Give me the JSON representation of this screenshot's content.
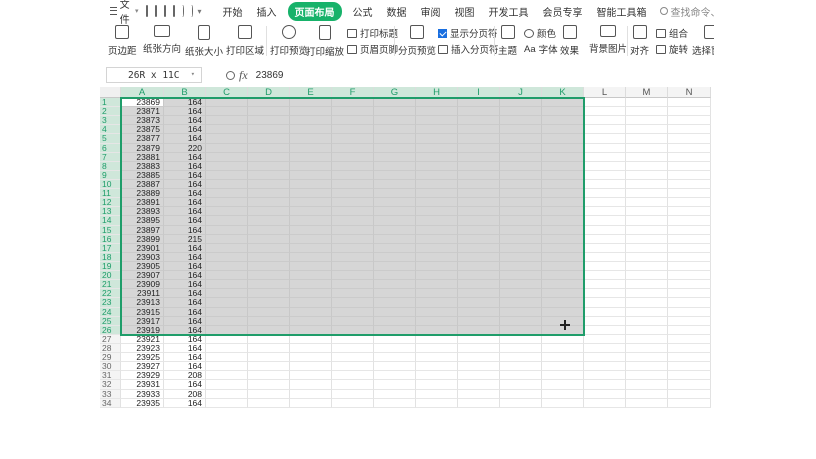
{
  "menubar": {
    "file_label": "文件",
    "tabs": [
      "开始",
      "插入",
      "页面布局",
      "公式",
      "数据",
      "审阅",
      "视图",
      "开发工具",
      "会员专享",
      "智能工具箱"
    ],
    "active_tab": "页面布局",
    "search_placeholder": "查找命令、搜索模板"
  },
  "ribbon": {
    "margins": "页边距",
    "orientation": "纸张方向",
    "size": "纸张大小",
    "print_area": "打印区域",
    "print_preview": "打印预览",
    "print_scale": "打印缩放",
    "print_titles": "打印标题",
    "header_footer": "页眉页脚",
    "page_break_preview": "分页预览",
    "show_page_break": "显示分页符",
    "insert_page_break": "插入分页符",
    "theme": "主题",
    "colors": "颜色",
    "fonts": "字体",
    "effects": "效果",
    "background": "背景图片",
    "align": "对齐",
    "group": "组合",
    "rotate": "旋转",
    "selection_pane": "选择窗格"
  },
  "formula_bar": {
    "name_box": "26R x 11C",
    "fx": "fx",
    "value": "23869"
  },
  "grid": {
    "columns": [
      "A",
      "B",
      "C",
      "D",
      "E",
      "F",
      "G",
      "H",
      "I",
      "J",
      "K",
      "L",
      "M",
      "N"
    ],
    "selected_columns": 11,
    "selected_rows": 26,
    "rows": [
      [
        "1",
        "23869",
        "164"
      ],
      [
        "2",
        "23871",
        "164"
      ],
      [
        "3",
        "23873",
        "164"
      ],
      [
        "4",
        "23875",
        "164"
      ],
      [
        "5",
        "23877",
        "164"
      ],
      [
        "6",
        "23879",
        "220"
      ],
      [
        "7",
        "23881",
        "164"
      ],
      [
        "8",
        "23883",
        "164"
      ],
      [
        "9",
        "23885",
        "164"
      ],
      [
        "10",
        "23887",
        "164"
      ],
      [
        "11",
        "23889",
        "164"
      ],
      [
        "12",
        "23891",
        "164"
      ],
      [
        "13",
        "23893",
        "164"
      ],
      [
        "14",
        "23895",
        "164"
      ],
      [
        "15",
        "23897",
        "164"
      ],
      [
        "16",
        "23899",
        "215"
      ],
      [
        "17",
        "23901",
        "164"
      ],
      [
        "18",
        "23903",
        "164"
      ],
      [
        "19",
        "23905",
        "164"
      ],
      [
        "20",
        "23907",
        "164"
      ],
      [
        "21",
        "23909",
        "164"
      ],
      [
        "22",
        "23911",
        "164"
      ],
      [
        "23",
        "23913",
        "164"
      ],
      [
        "24",
        "23915",
        "164"
      ],
      [
        "25",
        "23917",
        "164"
      ],
      [
        "26",
        "23919",
        "164"
      ],
      [
        "27",
        "23921",
        "164"
      ],
      [
        "28",
        "23923",
        "164"
      ],
      [
        "29",
        "23925",
        "164"
      ],
      [
        "30",
        "23927",
        "164"
      ],
      [
        "31",
        "23929",
        "208"
      ],
      [
        "32",
        "23931",
        "164"
      ],
      [
        "33",
        "23933",
        "208"
      ],
      [
        "34",
        "23935",
        "164"
      ]
    ]
  },
  "colors": {
    "accent": "#17b26a",
    "selection_border": "#1f9d6a",
    "selection_fill": "#d6d6d6"
  }
}
